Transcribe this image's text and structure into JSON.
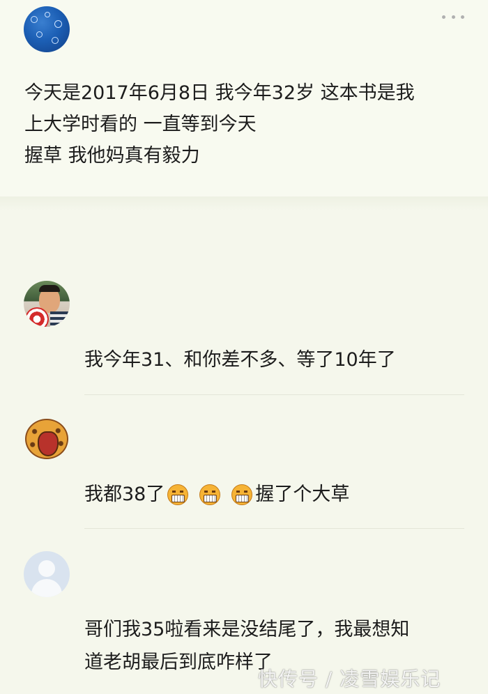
{
  "post": {
    "avatar_icon": "blue-pattern-avatar",
    "more_icon": "more-dots-icon",
    "text": "今天是2017年6月8日 我今年32岁 这本书是我\n上大学时看的 一直等到今天\n握草 我他妈真有毅力"
  },
  "comments": [
    {
      "avatar_icon": "man-photo-avatar",
      "text": "我今年31、和你差不多、等了10年了"
    },
    {
      "avatar_icon": "roaring-lion-avatar",
      "text_before": "我都38了",
      "emoji_icons": [
        "angry-face-emoji",
        "angry-face-emoji",
        "angry-face-emoji"
      ],
      "text_after": "握了个大草"
    },
    {
      "avatar_icon": "default-user-avatar",
      "text": "哥们我35啦看来是没结尾了，我最想知\n道老胡最后到底咋样了"
    }
  ],
  "watermark": "快传号 / 凌雪娱乐记",
  "colors": {
    "background": "#f5f7ec",
    "text": "#1c1c1c",
    "separator": "#e3e6d8"
  }
}
